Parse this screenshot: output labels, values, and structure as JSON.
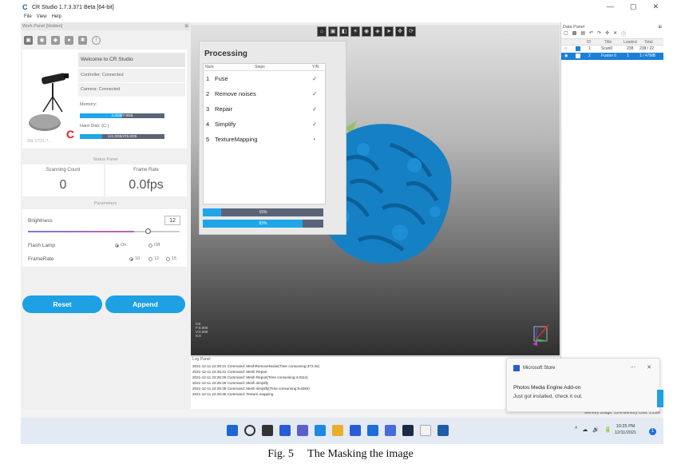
{
  "window": {
    "title": "CR Studio 1.7.3.371 Beta [64-bit]",
    "app_letter": "C",
    "controls": [
      "—",
      "▢",
      "✕"
    ]
  },
  "menu": [
    "File",
    "View",
    "Help"
  ],
  "work_panel": {
    "title": "Work Panel [Hidden]",
    "welcome": "Welcome to CR Studio",
    "controller": "Controller: Connected",
    "camera": "Camera: Connected",
    "memory_label": "Memory:",
    "memory_value": "4.3GB/7.9GB",
    "memory_fraction": 0.5,
    "disk_label": "Hard Disk: (C:)",
    "disk_value": "121.3GB/475.8GB",
    "disk_fraction": 0.26,
    "serial": "SN: CT21-7...",
    "reload_glyph": "C"
  },
  "status_panel": {
    "header": "Status Panel",
    "scanning_count_label": "Scanning Count",
    "scanning_count": "0",
    "frame_rate_label": "Frame Rate",
    "frame_rate": "0.0fps"
  },
  "parameters": {
    "header": "Parameters",
    "brightness_label": "Brightness",
    "brightness_value": "12",
    "brightness_fraction": 0.78,
    "flash_lamp_label": "Flash Lamp",
    "flash_on": "On",
    "flash_off": "Off",
    "frame_rate_label": "FrameRate",
    "frame_rates": [
      "10",
      "12",
      "15"
    ]
  },
  "buttons": {
    "reset": "Reset",
    "append": "Append"
  },
  "viewport": {
    "axis_info": [
      "CS",
      "F:0.000",
      "V:0.000",
      "S:0"
    ],
    "toolbar_icons": [
      "home-icon",
      "front-view-icon",
      "side-view-icon",
      "light-icon",
      "eye-icon",
      "mesh-icon",
      "cursor-icon",
      "move-icon",
      "rotate-icon"
    ]
  },
  "processing": {
    "title": "Processing",
    "col_num": "Num",
    "col_steps": "Steps",
    "col_yn": "Y/N",
    "steps": [
      {
        "num": "1",
        "name": "Fuse",
        "status": "✓"
      },
      {
        "num": "2",
        "name": "Remove noises",
        "status": "✓"
      },
      {
        "num": "3",
        "name": "Repair",
        "status": "✓"
      },
      {
        "num": "4",
        "name": "Simplify",
        "status": "✓"
      },
      {
        "num": "5",
        "name": "TextureMapping",
        "status": "◔"
      }
    ],
    "progress1_label": "15%",
    "progress1": 0.15,
    "progress2_label": "83%",
    "progress2": 0.83
  },
  "log": {
    "title": "Log Panel",
    "lines": [
      "2021-12-11 22:25:21 Command: MeshRemoveNoise(Time consuming:372.0s)",
      "2021-12-11 22:25:21 Command: Mesh Repair",
      "2021-12-11 22:25:26 Command: Mesh Repair(Time consuming:4.811s)",
      "2021-12-11 22:25:26 Command: Mesh simplify",
      "2021-12-11 22:25:36 Command: Mesh simplify(Time consuming:9.628s)",
      "2021-12-11 22:25:36 Command: Texture mapping"
    ]
  },
  "data_panel": {
    "title": "Data Panel",
    "tool_icons": [
      "new-icon",
      "delete-icon",
      "copy-icon",
      "undo-icon",
      "redo-icon",
      "merge-icon",
      "close-icon",
      "info-icon"
    ],
    "headers": [
      "ID",
      "Title",
      "Loaded",
      "Total"
    ],
    "rows": [
      {
        "id": "1",
        "title": "Scan0",
        "loaded": "238",
        "total": "238 / 22",
        "selected": false
      },
      {
        "id": "2",
        "title": "Fusion 0",
        "loaded": "1",
        "total": "1 / 47MB",
        "selected": true
      }
    ]
  },
  "notification": {
    "source": "Microsoft Store",
    "title": "Photos Media Engine Add-on",
    "body": "Just got installed, check it out."
  },
  "statusline": {
    "memory": "Memory Usage: 15%   Memory Cost: 1.2GB"
  },
  "taskbar": {
    "icons": [
      {
        "name": "start-icon",
        "color": "#1e66d0"
      },
      {
        "name": "search-icon",
        "color": "#333333"
      },
      {
        "name": "task-view-icon",
        "color": "#333333"
      },
      {
        "name": "widgets-icon",
        "color": "#2a5bd7"
      },
      {
        "name": "teams-icon",
        "color": "#5b5fc7"
      },
      {
        "name": "edge-icon",
        "color": "#1b8ae0"
      },
      {
        "name": "explorer-icon",
        "color": "#e8b028"
      },
      {
        "name": "store-icon",
        "color": "#2a5bd7"
      },
      {
        "name": "mail-icon",
        "color": "#1a6fd8"
      },
      {
        "name": "photos-icon",
        "color": "#4a6ad8"
      },
      {
        "name": "steam-icon",
        "color": "#1d2a44"
      },
      {
        "name": "notepad-icon",
        "color": "#f3f3f3"
      },
      {
        "name": "crstudio-icon",
        "color": "#1e5ea8"
      }
    ],
    "tray": [
      "^",
      "☁",
      "🔊",
      "🔋"
    ],
    "time": "10:25 PM",
    "date": "12/11/2021",
    "badge": "1"
  },
  "caption": "Fig. 5     The Masking the image",
  "colors": {
    "accent": "#1ea0e4",
    "mesh": "#1680c4",
    "selection": "#1a7fd8",
    "reload": "#e02020"
  }
}
